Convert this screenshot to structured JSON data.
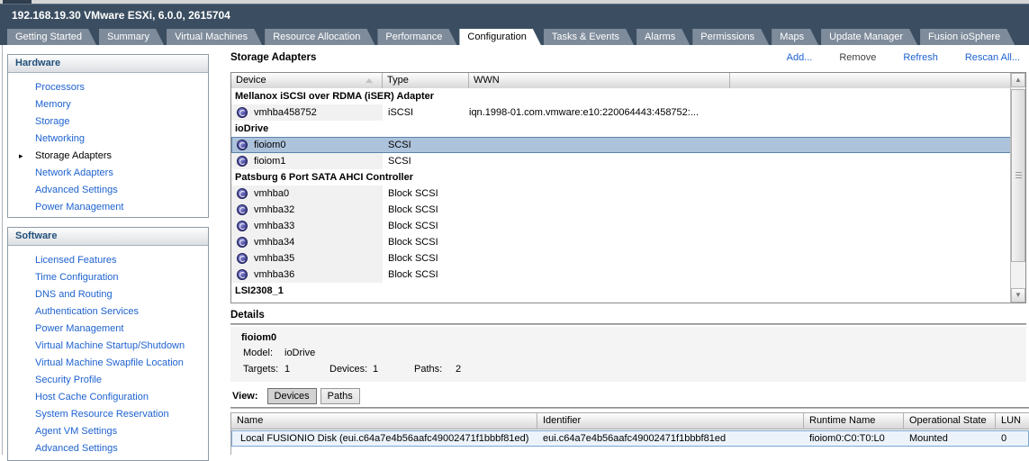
{
  "window": {
    "title": "192.168.19.30 VMware ESXi, 6.0.0, 2615704"
  },
  "tabs": [
    {
      "label": "Getting Started",
      "active": false
    },
    {
      "label": "Summary",
      "active": false
    },
    {
      "label": "Virtual Machines",
      "active": false
    },
    {
      "label": "Resource Allocation",
      "active": false
    },
    {
      "label": "Performance",
      "active": false
    },
    {
      "label": "Configuration",
      "active": true
    },
    {
      "label": "Tasks & Events",
      "active": false
    },
    {
      "label": "Alarms",
      "active": false
    },
    {
      "label": "Permissions",
      "active": false
    },
    {
      "label": "Maps",
      "active": false
    },
    {
      "label": "Update Manager",
      "active": false
    },
    {
      "label": "Fusion ioSphere",
      "active": false
    }
  ],
  "sidebar": {
    "hardware": {
      "title": "Hardware",
      "items": [
        {
          "label": "Processors",
          "selected": false
        },
        {
          "label": "Memory",
          "selected": false
        },
        {
          "label": "Storage",
          "selected": false
        },
        {
          "label": "Networking",
          "selected": false
        },
        {
          "label": "Storage Adapters",
          "selected": true
        },
        {
          "label": "Network Adapters",
          "selected": false
        },
        {
          "label": "Advanced Settings",
          "selected": false
        },
        {
          "label": "Power Management",
          "selected": false
        }
      ]
    },
    "software": {
      "title": "Software",
      "items": [
        {
          "label": "Licensed Features",
          "selected": false
        },
        {
          "label": "Time Configuration",
          "selected": false
        },
        {
          "label": "DNS and Routing",
          "selected": false
        },
        {
          "label": "Authentication Services",
          "selected": false
        },
        {
          "label": "Power Management",
          "selected": false
        },
        {
          "label": "Virtual Machine Startup/Shutdown",
          "selected": false
        },
        {
          "label": "Virtual Machine Swapfile Location",
          "selected": false
        },
        {
          "label": "Security Profile",
          "selected": false
        },
        {
          "label": "Host Cache Configuration",
          "selected": false
        },
        {
          "label": "System Resource Reservation",
          "selected": false
        },
        {
          "label": "Agent VM Settings",
          "selected": false
        },
        {
          "label": "Advanced Settings",
          "selected": false
        }
      ]
    }
  },
  "main": {
    "title": "Storage Adapters",
    "actions": [
      {
        "label": "Add...",
        "enabled": true
      },
      {
        "label": "Remove",
        "enabled": false
      },
      {
        "label": "Refresh",
        "enabled": true
      },
      {
        "label": "Rescan All...",
        "enabled": true
      }
    ],
    "adapter_table": {
      "columns": [
        "Device",
        "Type",
        "WWN"
      ],
      "groups": [
        {
          "name": "Mellanox iSCSI over RDMA (iSER) Adapter",
          "rows": [
            {
              "device": "vmhba458752",
              "type": "iSCSI",
              "wwn": "iqn.1998-01.com.vmware:e10:220064443:458752:...",
              "selected": false
            }
          ]
        },
        {
          "name": "ioDrive",
          "rows": [
            {
              "device": "fioiom0",
              "type": "SCSI",
              "wwn": "",
              "selected": true
            },
            {
              "device": "fioiom1",
              "type": "SCSI",
              "wwn": "",
              "selected": false
            }
          ]
        },
        {
          "name": "Patsburg 6 Port SATA AHCI Controller",
          "rows": [
            {
              "device": "vmhba0",
              "type": "Block SCSI",
              "wwn": "",
              "selected": false
            },
            {
              "device": "vmhba32",
              "type": "Block SCSI",
              "wwn": "",
              "selected": false
            },
            {
              "device": "vmhba33",
              "type": "Block SCSI",
              "wwn": "",
              "selected": false
            },
            {
              "device": "vmhba34",
              "type": "Block SCSI",
              "wwn": "",
              "selected": false
            },
            {
              "device": "vmhba35",
              "type": "Block SCSI",
              "wwn": "",
              "selected": false
            },
            {
              "device": "vmhba36",
              "type": "Block SCSI",
              "wwn": "",
              "selected": false
            }
          ]
        },
        {
          "name": "LSI2308_1",
          "rows": []
        }
      ]
    },
    "details": {
      "title": "Details",
      "adapter_name": "fioiom0",
      "model_label": "Model:",
      "model": "ioDrive",
      "targets_label": "Targets:",
      "targets": "1",
      "devices_label": "Devices:",
      "devices": "1",
      "paths_label": "Paths:",
      "paths": "2",
      "view_label": "View:",
      "view_buttons": [
        {
          "label": "Devices",
          "active": true
        },
        {
          "label": "Paths",
          "active": false
        }
      ]
    },
    "device_table": {
      "columns": [
        "Name",
        "Identifier",
        "Runtime Name",
        "Operational State",
        "LUN"
      ],
      "rows": [
        {
          "name": "Local FUSIONIO Disk (eui.c64a7e4b56aafc49002471f1bbbf81ed)",
          "identifier": "eui.c64a7e4b56aafc49002471f1bbbf81ed",
          "runtime_name": "fioiom0:C0:T0:L0",
          "operational_state": "Mounted",
          "lun": "0",
          "selected": true
        }
      ]
    }
  },
  "colors": {
    "titlebar_bg": "#3b4e61",
    "tab_inactive_bg": "#7e8b9b",
    "link_blue": "#1e62d0",
    "sidebar_header_text": "#1f4e79",
    "selection_blue": "#adc3dc",
    "selected_device_row_bg": "#ecf3fb"
  }
}
